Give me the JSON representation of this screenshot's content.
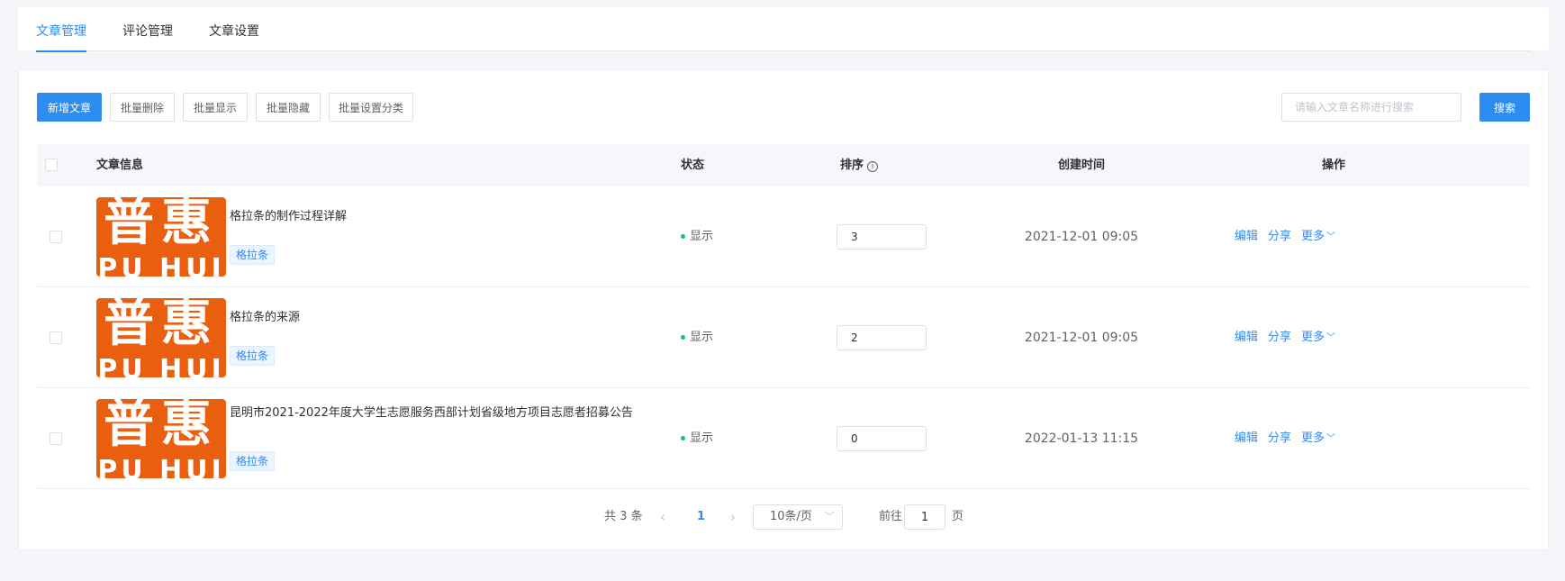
{
  "tabs": [
    {
      "label": "文章管理",
      "active": true
    },
    {
      "label": "评论管理",
      "active": false
    },
    {
      "label": "文章设置",
      "active": false
    }
  ],
  "toolbar": {
    "add_label": "新增文章",
    "batch_delete_label": "批量删除",
    "batch_show_label": "批量显示",
    "batch_hide_label": "批量隐藏",
    "batch_category_label": "批量设置分类",
    "search_placeholder": "请输入文章名称进行搜索",
    "search_value": "",
    "search_button_label": "搜索"
  },
  "table": {
    "columns": {
      "info": "文章信息",
      "status": "状态",
      "sort": "排序",
      "created": "创建时间",
      "actions": "操作"
    },
    "sort_info_icon": "info-circle-icon",
    "rows": [
      {
        "thumb_cn": "普惠",
        "thumb_en": "PU HUI",
        "title": "格拉条的制作过程详解",
        "tag": "格拉条",
        "status": "显示",
        "sort": "3",
        "created": "2021-12-01 09:05",
        "edit": "编辑",
        "share": "分享",
        "more": "更多"
      },
      {
        "thumb_cn": "普惠",
        "thumb_en": "PU HUI",
        "title": "格拉条的来源",
        "tag": "格拉条",
        "status": "显示",
        "sort": "2",
        "created": "2021-12-01 09:05",
        "edit": "编辑",
        "share": "分享",
        "more": "更多"
      },
      {
        "thumb_cn": "普惠",
        "thumb_en": "PU HUI",
        "title": "昆明市2021-2022年度大学生志愿服务西部计划省级地方项目志愿者招募公告",
        "tag": "格拉条",
        "status": "显示",
        "sort": "0",
        "created": "2022-01-13 11:15",
        "edit": "编辑",
        "share": "分享",
        "more": "更多"
      }
    ]
  },
  "pagination": {
    "total_text": "共 3 条",
    "current_page": "1",
    "page_size": "10条/页",
    "goto_label": "前往",
    "goto_value": "1",
    "page_suffix": "页"
  },
  "colors": {
    "accent": "#2d8cf0",
    "status_dot": "#19be6b",
    "thumb_bg": "#ea5e10"
  }
}
